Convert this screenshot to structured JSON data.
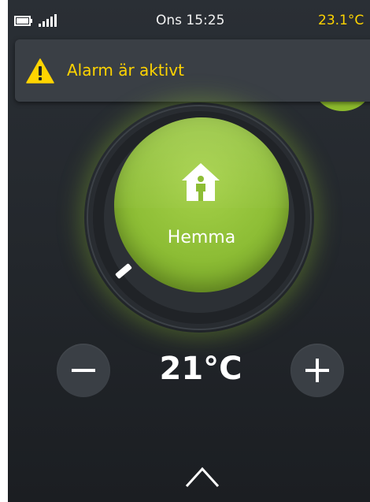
{
  "status_bar": {
    "clock": "Ons 15:25",
    "outdoor_temp": "23.1°C",
    "battery_icon": "battery-icon",
    "signal_icon": "signal-icon"
  },
  "alarm_banner": {
    "text": "Alarm är aktivt",
    "icon": "warning-icon",
    "color": "#ffd400"
  },
  "mode": {
    "label": "Hemma",
    "icon": "home-person-icon",
    "color": "#8dbd35"
  },
  "temperature": {
    "value": "21°C",
    "decrease_icon": "minus-icon",
    "increase_icon": "plus-icon"
  },
  "footer": {
    "expand_icon": "chevron-up-icon"
  }
}
